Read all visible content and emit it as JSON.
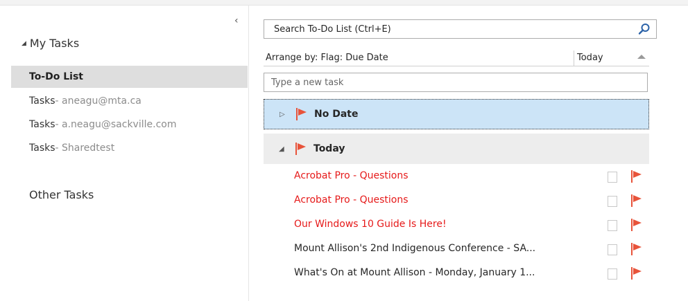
{
  "nav": {
    "collapse_glyph": "‹",
    "group_label": "My Tasks",
    "items": [
      {
        "label": "To-Do List",
        "account": ""
      },
      {
        "label": "Tasks",
        "account": " - aneagu@mta.ca"
      },
      {
        "label": "Tasks",
        "account": " - a.neagu@sackville.com"
      },
      {
        "label": "Tasks",
        "account": " - Sharedtest"
      }
    ],
    "other_label": "Other Tasks"
  },
  "search": {
    "placeholder": "Search To-Do List (Ctrl+E)"
  },
  "arrange": {
    "label": "Arrange by: Flag: Due Date",
    "sort_column": "Today"
  },
  "newtask": {
    "placeholder": "Type a new task"
  },
  "groups": {
    "nodate": "No Date",
    "today": "Today"
  },
  "tasks": [
    {
      "subject": "Acrobat Pro - Questions"
    },
    {
      "subject": "Acrobat Pro - Questions"
    },
    {
      "subject": "Our Windows 10 Guide Is Here!"
    },
    {
      "subject": "Mount Allison's 2nd Indigenous Conference - SA..."
    },
    {
      "subject": "What's On at Mount Allison - Monday, January 1..."
    }
  ],
  "colors": {
    "selected_group": "#cce4f7",
    "flag": "#e8533a",
    "unread": "#e61919"
  }
}
